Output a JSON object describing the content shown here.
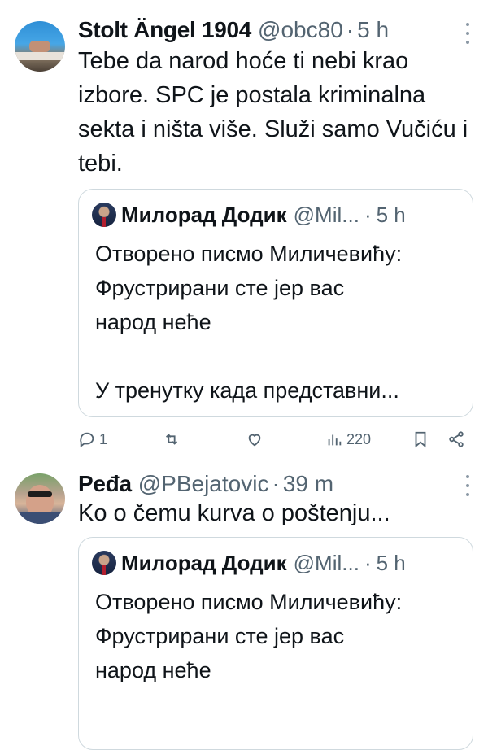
{
  "tweets": [
    {
      "name": "Stolt Ängel 1904",
      "handle": "@obc80",
      "separator": "·",
      "time": "5 h",
      "text": "Tebe da narod hoće ti nebi krao izbore. SPC je postala kriminalna sekta i ništa više. Služi samo Vučiću i tebi.",
      "quote": {
        "name": "Милорад Додик",
        "handle": "@Mil...",
        "separator": "·",
        "time": "5 h",
        "text": "Отворено писмо Миличевићу:\nФрустрирани сте јер вас\nнарод неће\n\nУ тренутку када представни..."
      },
      "actions": {
        "replies": "1",
        "reposts": "",
        "likes": "",
        "views": "220"
      }
    },
    {
      "name": "Peđa",
      "handle": "@PBejatovic",
      "separator": "·",
      "time": "39 m",
      "text": "Ko o čemu kurva o poštenju...",
      "quote": {
        "name": "Милорад Додик",
        "handle": "@Mil...",
        "separator": "·",
        "time": "5 h",
        "text": "Отворено писмо Миличевићу:\nФрустрирани сте јер вас\nнарод неће"
      }
    }
  ],
  "icons": {
    "reply": "reply-icon",
    "repost": "repost-icon",
    "like": "heart-icon",
    "views": "views-icon",
    "bookmark": "bookmark-icon",
    "share": "share-icon",
    "more": "more-options-icon"
  },
  "colors": {
    "text": "#0f1419",
    "secondary": "#536471",
    "border": "#cfd9de"
  }
}
